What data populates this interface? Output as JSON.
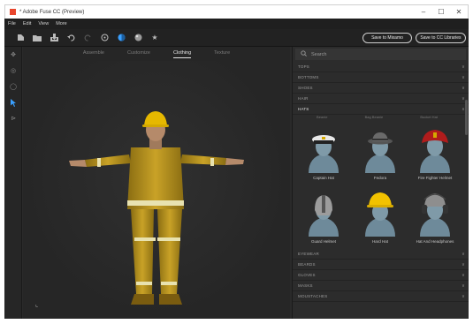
{
  "window": {
    "title": "* Adobe Fuse CC (Preview)",
    "minimize": "–",
    "maximize": "☐",
    "close": "✕"
  },
  "menu": [
    "File",
    "Edit",
    "View",
    "More"
  ],
  "toolbar": {
    "save_mixamo": "Save to Mixamo",
    "save_cc": "Save to CC Libraries"
  },
  "tabs": [
    "Assemble",
    "Customize",
    "Clothing",
    "Texture"
  ],
  "active_tab": "Clothing",
  "search": {
    "placeholder": "Search"
  },
  "categories_top": [
    "TOPS",
    "BOTTOMS",
    "SHOES",
    "HAIR"
  ],
  "open_category": "HATS",
  "hat_top_labels": [
    "Beanie",
    "Bag Beanie",
    "Bucket Hat"
  ],
  "hats": [
    {
      "label": "Captain Hat"
    },
    {
      "label": "Fedora"
    },
    {
      "label": "Fire Fighter Helmet"
    },
    {
      "label": "Guard Helmet"
    },
    {
      "label": "Hard Hat"
    },
    {
      "label": "Hat And Headphones"
    }
  ],
  "categories_bottom": [
    "EYEWEAR",
    "BEARDS",
    "GLOVES",
    "MASKS",
    "MOUSTACHES"
  ],
  "colors": {
    "accent": "#3aa0ff",
    "app_icon": "#e8462d",
    "uniform": "#c9a227",
    "reflective": "#e8e2b0",
    "silhouette": "#6e8a9a"
  }
}
